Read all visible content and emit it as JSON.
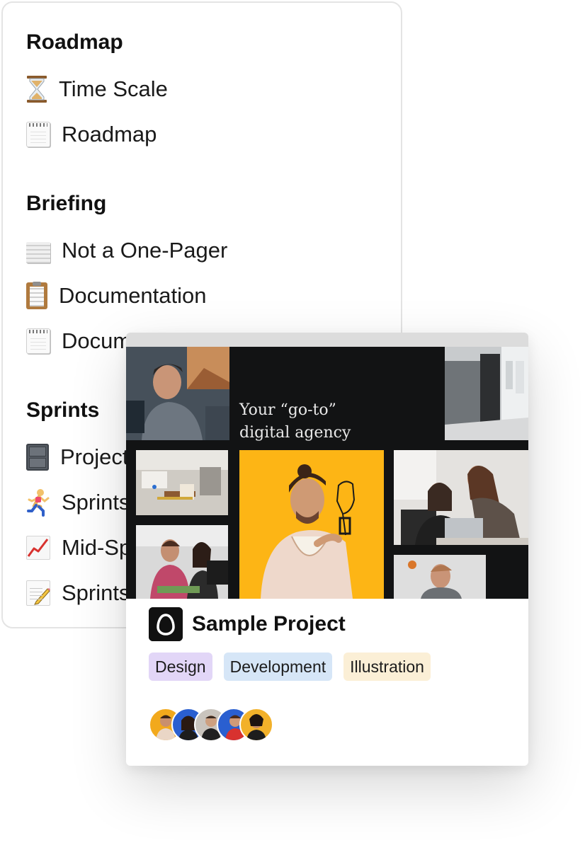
{
  "sidebar": {
    "sections": [
      {
        "title": "Roadmap",
        "items": [
          {
            "label": "Time Scale",
            "icon": "hourglass-icon"
          },
          {
            "label": "Roadmap",
            "icon": "spiral-calendar-icon"
          }
        ]
      },
      {
        "title": "Briefing",
        "items": [
          {
            "label": "Not a One-Pager",
            "icon": "page-icon"
          },
          {
            "label": "Documentation",
            "icon": "clipboard-icon"
          },
          {
            "label": "Documentation",
            "icon": "spiral-notepad-icon"
          }
        ]
      },
      {
        "title": "Sprints",
        "items": [
          {
            "label": "Projects",
            "icon": "file-cabinet-icon"
          },
          {
            "label": "Sprints",
            "icon": "runner-icon"
          },
          {
            "label": "Mid-Sprint",
            "icon": "chart-increasing-icon"
          },
          {
            "label": "Sprints",
            "icon": "memo-icon"
          }
        ]
      }
    ]
  },
  "card": {
    "cover": {
      "tagline": "Your “go-to”\ndigital agency"
    },
    "title": "Sample Project",
    "logo_icon": "egg-logo-icon",
    "tags": [
      {
        "label": "Design",
        "color": "#e2d6f7"
      },
      {
        "label": "Development",
        "color": "#d6e6f7"
      },
      {
        "label": "Illustration",
        "color": "#fbefd6"
      }
    ],
    "avatars": [
      {
        "name": "avatar-1",
        "bg": "#f2a91c"
      },
      {
        "name": "avatar-2",
        "bg": "#2a5fd0"
      },
      {
        "name": "avatar-3",
        "bg": "#c9c4bd"
      },
      {
        "name": "avatar-4",
        "bg": "#2a5fd0"
      },
      {
        "name": "avatar-5",
        "bg": "#f2b12a"
      }
    ]
  },
  "colors": {
    "accent_yellow": "#fdb515",
    "cover_dark": "#121314"
  }
}
